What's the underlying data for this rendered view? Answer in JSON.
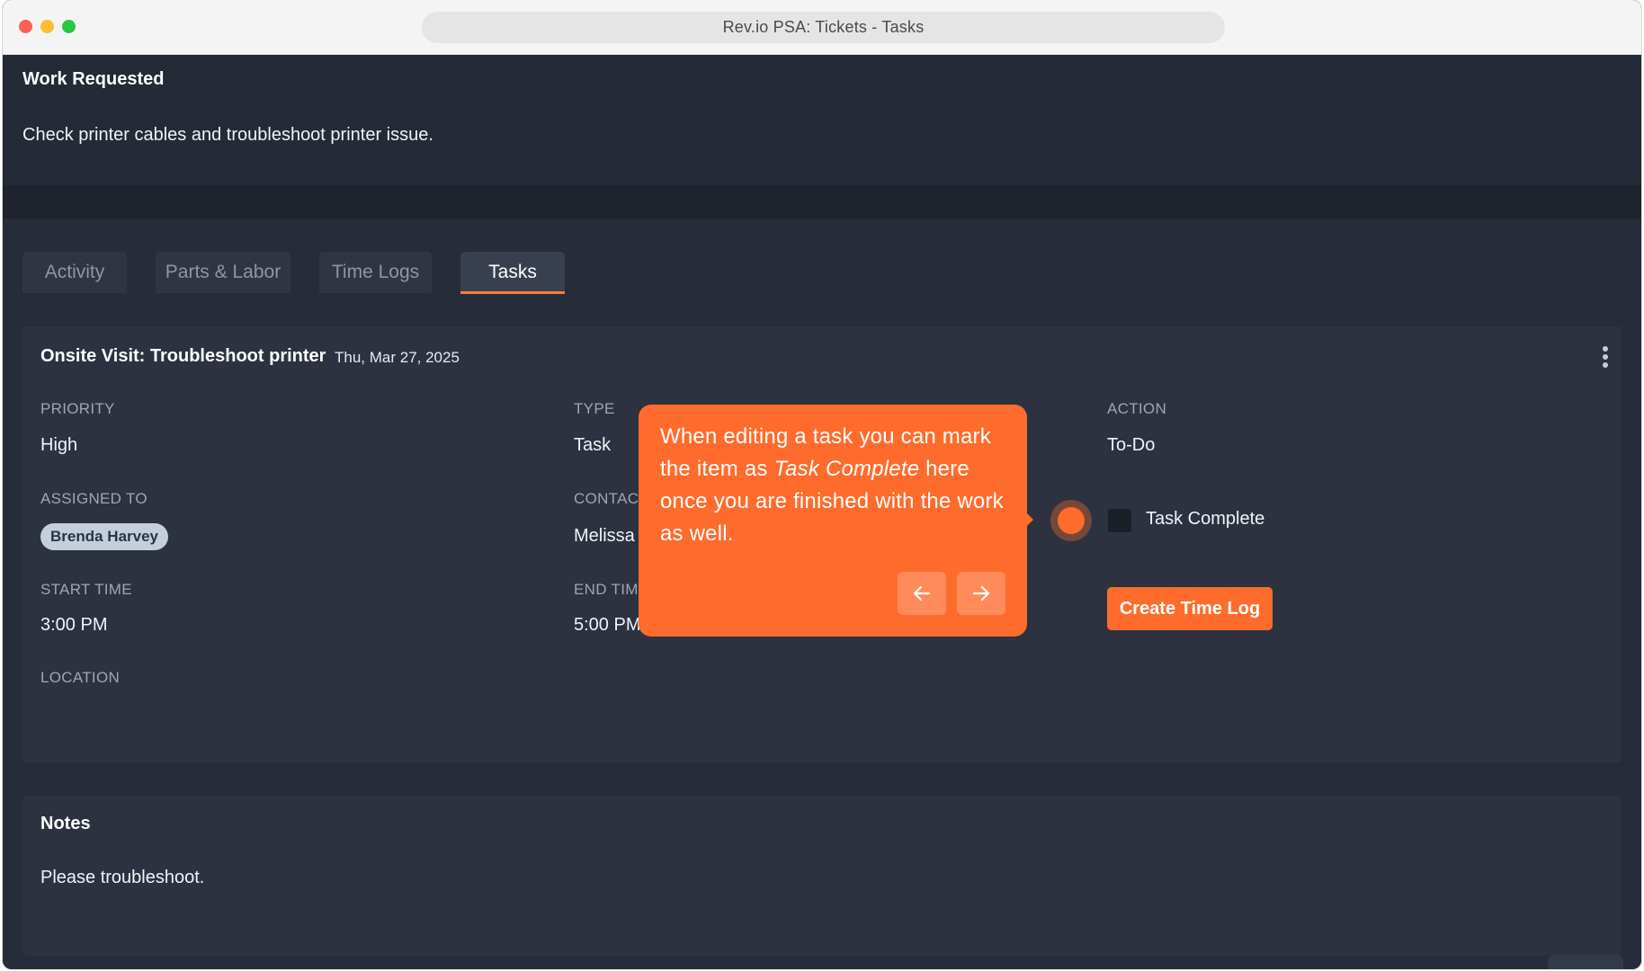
{
  "window": {
    "title": "Rev.io PSA: Tickets - Tasks"
  },
  "work_requested": {
    "title": "Work Requested",
    "text": "Check printer cables and troubleshoot printer issue."
  },
  "tabs": [
    {
      "label": "Activity",
      "active": false
    },
    {
      "label": "Parts & Labor",
      "active": false
    },
    {
      "label": "Time Logs",
      "active": false
    },
    {
      "label": "Tasks",
      "active": true
    }
  ],
  "task": {
    "title": "Onsite Visit: Troubleshoot printer",
    "date": "Thu, Mar 27, 2025",
    "priority_label": "PRIORITY",
    "priority_value": "High",
    "type_label": "TYPE",
    "type_value": "Task",
    "action_label": "ACTION",
    "action_value": "To-Do",
    "assigned_label": "ASSIGNED TO",
    "assigned_value": "Brenda Harvey",
    "contact_label": "CONTAC",
    "contact_value": "Melissa",
    "start_label": "START TIME",
    "start_value": "3:00 PM",
    "end_label": "END TIM",
    "end_value": "5:00 PM",
    "location_label": "LOCATION",
    "task_complete_label": "Task Complete",
    "task_complete_checked": false,
    "create_time_log_label": "Create Time Log"
  },
  "tooltip": {
    "text_before": "When editing a task you can mark the item as ",
    "text_em": "Task Complete",
    "text_after": " here once you are finished with the work as well.",
    "prev_icon": "arrow-left-icon",
    "next_icon": "arrow-right-icon"
  },
  "notes": {
    "title": "Notes",
    "text": "Please troubleshoot."
  },
  "colors": {
    "accent": "#ff6b2c",
    "background": "#262c38",
    "card": "#2c3240"
  }
}
